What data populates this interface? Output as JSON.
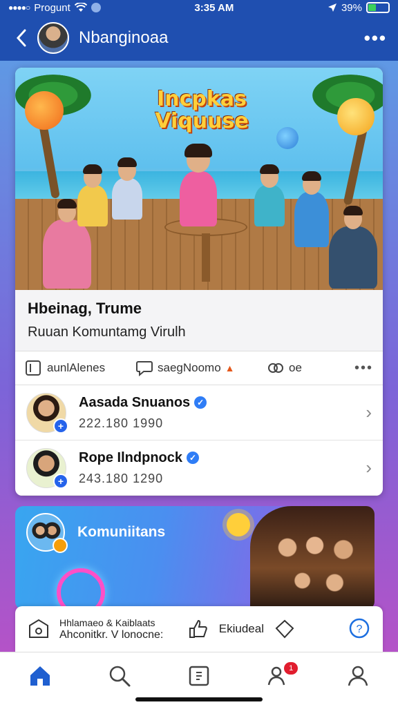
{
  "status_bar": {
    "carrier": "Progunt",
    "time": "3:35 AM",
    "battery": "39%",
    "battery_level": 0.39
  },
  "header": {
    "title": "Nbanginoaa"
  },
  "post": {
    "hero_title": "Incpkas Viquuse",
    "title": "Hbeinag, Trume",
    "subtitle": "Ruuan Komuntamg Virulh",
    "actions": {
      "like_label": "aunlAlenes",
      "share_label": "saegNoomo",
      "react_label": "oe"
    }
  },
  "members": [
    {
      "name": "Aasada Snuanos",
      "number": "222.180 1990"
    },
    {
      "name": "Rope Ilndpnock",
      "number": "243.180 1290"
    }
  ],
  "community": {
    "name": "Komuniitans"
  },
  "quick_actions": {
    "line1": "Hhlamaeo & Kaiblaats",
    "line2": "Ahconitkr. V lonocne:",
    "button_label": "Ekiudeal"
  },
  "bottom_nav": {
    "notification_count": "1",
    "active": "home"
  },
  "colors": {
    "header": "#1f4fb0",
    "accent": "#2563eb",
    "badge": "#e11d2e"
  }
}
